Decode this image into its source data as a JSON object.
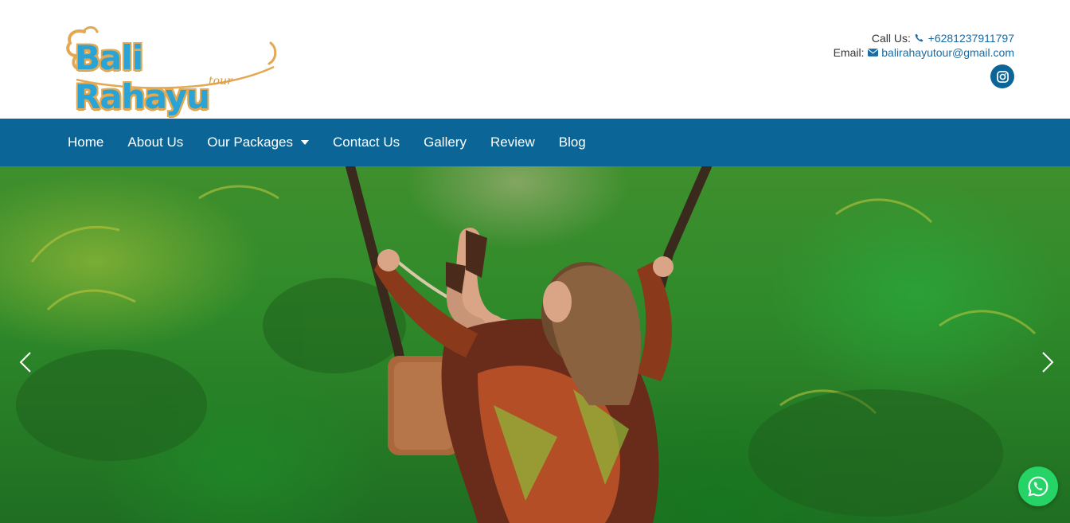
{
  "brand": {
    "name": "Bali Rahayu",
    "tagline": "tour",
    "colors": {
      "primary": "#0b6597",
      "logo_blue": "#2aa3d6",
      "logo_gold": "#e3a852",
      "whatsapp": "#25d366"
    }
  },
  "contact": {
    "call_label": "Call Us:",
    "phone": "+6281237911797",
    "phone_icon": "phone-icon",
    "email_label": "Email:",
    "email": "balirahayutour@gmail.com",
    "email_icon": "envelope-icon",
    "social_icon": "instagram-icon"
  },
  "nav": {
    "items": [
      {
        "label": "Home"
      },
      {
        "label": "About Us"
      },
      {
        "label": "Our Packages",
        "has_dropdown": true
      },
      {
        "label": "Contact Us"
      },
      {
        "label": "Gallery"
      },
      {
        "label": "Review"
      },
      {
        "label": "Blog"
      }
    ]
  },
  "hero": {
    "prev_icon": "chevron-left-icon",
    "next_icon": "chevron-right-icon"
  },
  "floating": {
    "whatsapp_icon": "whatsapp-icon"
  }
}
